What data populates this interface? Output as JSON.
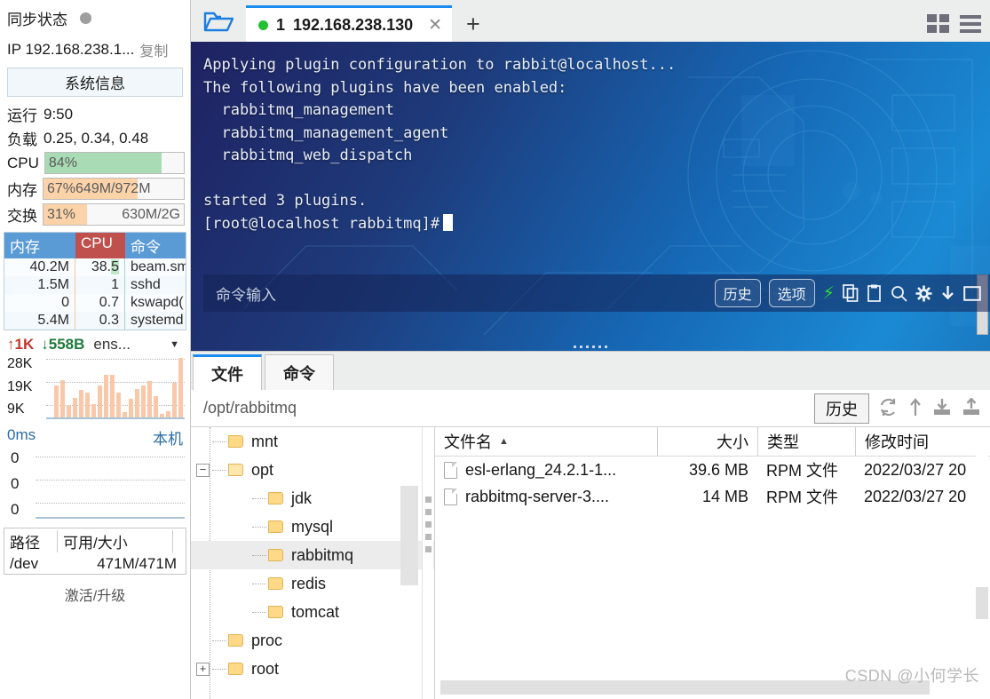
{
  "sidebar": {
    "sync_label": "同步状态",
    "ip_label": "IP 192.168.238.1...",
    "copy_label": "复制",
    "sysinfo_label": "系统信息",
    "uptime_label": "运行",
    "uptime_value": "9:50",
    "load_label": "负载",
    "load_value": "0.25, 0.34, 0.48",
    "meters": [
      {
        "label": "CPU",
        "pct": "84%",
        "value": "",
        "fill": 84,
        "color": "#a9dcb4"
      },
      {
        "label": "内存",
        "pct": "67%",
        "value": "649M/972M",
        "fill": 67,
        "color": "#fcd3a9"
      },
      {
        "label": "交换",
        "pct": "31%",
        "value": "630M/2G",
        "fill": 31,
        "color": "#fcd3a9"
      }
    ],
    "proc_headers": {
      "mem": "内存",
      "cpu": "CPU",
      "cmd": "命令"
    },
    "proc_rows": [
      {
        "mem": "40.2M",
        "cpu": "38.5",
        "cmd": "beam.sm",
        "cpu_hl": true
      },
      {
        "mem": "1.5M",
        "cpu": "1",
        "cmd": "sshd",
        "cpu_hl": false
      },
      {
        "mem": "0",
        "cpu": "0.7",
        "cmd": "kswapd(",
        "cpu_hl": false
      },
      {
        "mem": "5.4M",
        "cpu": "0.3",
        "cmd": "systemd",
        "cpu_hl": false
      }
    ],
    "net": {
      "up": "1K",
      "down": "558B",
      "iface": "ens...",
      "y_labels": [
        "28K",
        "19K",
        "9K"
      ],
      "caret": "▼"
    },
    "ping": {
      "latency": "0ms",
      "target": "本机",
      "y_labels": [
        "0",
        "0",
        "0"
      ]
    },
    "disk": {
      "headers": {
        "path": "路径",
        "size": "可用/大小"
      },
      "rows": [
        {
          "path": "/dev",
          "size": "471M/471M"
        }
      ]
    },
    "activate_label": "激活/升级"
  },
  "titlebar": {
    "folder_icon": "open-folder-icon",
    "tab": {
      "index": "1",
      "title": "192.168.238.130",
      "close": "✕"
    },
    "newtab": "+",
    "grid_icon": "grid-view-icon",
    "menu_icon": "hamburger-menu-icon"
  },
  "terminal": {
    "lines": [
      "Applying plugin configuration to rabbit@localhost...",
      "The following plugins have been enabled:",
      "  rabbitmq_management",
      "  rabbitmq_management_agent",
      "  rabbitmq_web_dispatch",
      "",
      "started 3 plugins.",
      "[root@localhost rabbitmq]#"
    ],
    "input_placeholder": "命令输入",
    "history_label": "历史",
    "options_label": "选项",
    "icons": [
      "bolt-icon",
      "copy-icon",
      "paste-icon",
      "search-icon",
      "gear-icon",
      "download-icon",
      "window-icon"
    ]
  },
  "filepanel": {
    "tabs": [
      {
        "label": "文件",
        "active": true
      },
      {
        "label": "命令",
        "active": false
      }
    ],
    "path": "/opt/rabbitmq",
    "history_label": "历史",
    "toolbar_icons": [
      "refresh-icon",
      "parent-dir-icon",
      "download-icon",
      "upload-icon"
    ],
    "tree": [
      {
        "name": "mnt",
        "depth": 1,
        "expander": "",
        "selected": false
      },
      {
        "name": "opt",
        "depth": 1,
        "expander": "−",
        "selected": false
      },
      {
        "name": "jdk",
        "depth": 2,
        "expander": "",
        "selected": false
      },
      {
        "name": "mysql",
        "depth": 2,
        "expander": "",
        "selected": false
      },
      {
        "name": "rabbitmq",
        "depth": 2,
        "expander": "",
        "selected": true
      },
      {
        "name": "redis",
        "depth": 2,
        "expander": "",
        "selected": false
      },
      {
        "name": "tomcat",
        "depth": 2,
        "expander": "",
        "selected": false
      },
      {
        "name": "proc",
        "depth": 1,
        "expander": "",
        "selected": false
      },
      {
        "name": "root",
        "depth": 1,
        "expander": "+",
        "selected": false
      }
    ],
    "list_headers": {
      "name": "文件名",
      "size": "大小",
      "type": "类型",
      "time": "修改时间",
      "sort": "▲"
    },
    "list_rows": [
      {
        "name": "esl-erlang_24.2.1-1...",
        "size": "39.6 MB",
        "type": "RPM 文件",
        "time": "2022/03/27 20"
      },
      {
        "name": "rabbitmq-server-3....",
        "size": "14 MB",
        "type": "RPM 文件",
        "time": "2022/03/27 20"
      }
    ]
  },
  "watermark": "CSDN @小何学长",
  "colors": {
    "accent": "#1a8cf0",
    "header_blue": "#5b9bd5",
    "header_red": "#c0504d",
    "cpu_green": "#a9dcb4",
    "mem_orange": "#fcd3a9",
    "net_up": "#c0392b",
    "net_down": "#1e7a3c"
  }
}
